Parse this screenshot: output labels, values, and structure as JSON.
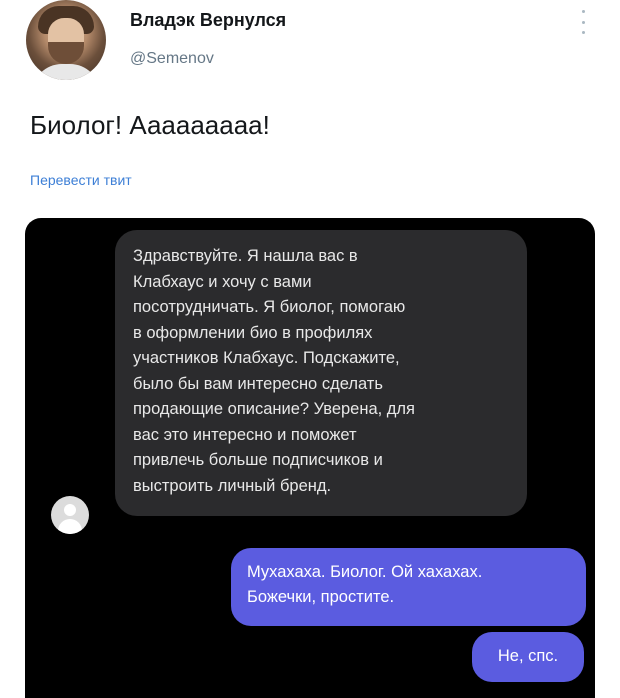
{
  "tweet": {
    "display_name": "Владэк Вернулся",
    "handle": "@Semenov",
    "text": "Биолог! Ааааааааа!",
    "translate_label": "Перевести твит"
  },
  "chat": {
    "incoming_lines": [
      "Здравствуйте. Я нашла вас в",
      "Клабхаус и хочу с вами",
      "посотрудничать. Я биолог, помогаю",
      "в оформлении био в профилях",
      "участников Клабхаус. Подскажите,",
      "было бы вам интересно сделать",
      "продающие описание? Уверена, для",
      "вас это интересно и поможет",
      "привлечь больше подписчиков и",
      "выстроить личный бренд."
    ],
    "outgoing_1_lines": [
      "Мухахаха. Биолог. Ой хахахах.",
      "Божечки, простите."
    ],
    "outgoing_2": "Не, спс."
  },
  "icons": {
    "more": "more-vertical-icon",
    "contact_avatar": "user-avatar-icon"
  },
  "colors": {
    "link": "#3d7fd6",
    "incoming_bubble": "#2b2b2d",
    "outgoing_bubble": "#5b5ce0"
  }
}
